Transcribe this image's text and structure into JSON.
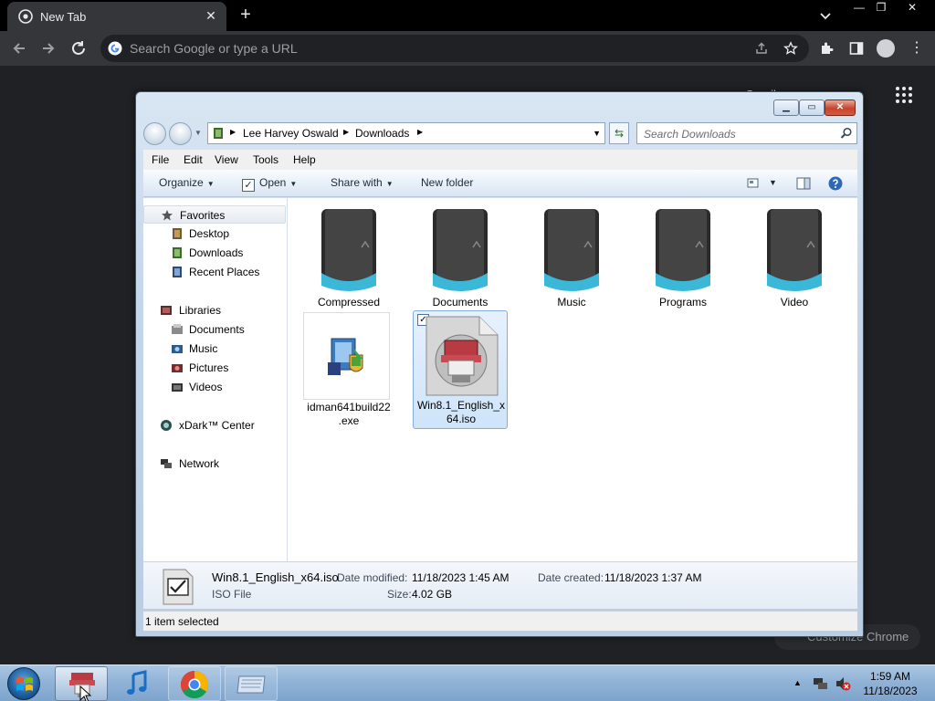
{
  "chrome": {
    "tab_title": "New Tab",
    "tab_close": "✕",
    "new_tab": "+",
    "omnibox_placeholder": "Search Google or type a URL",
    "menu_dots": "⋮",
    "gmail_link": "Gmail",
    "customize": "Customize Chrome",
    "window_min": "—",
    "window_restore": "❐",
    "window_close": "✕"
  },
  "explorer": {
    "breadcrumb": [
      "Lee Harvey Oswald",
      "Downloads"
    ],
    "search_placeholder": "Search Downloads",
    "menus": [
      "File",
      "Edit",
      "View",
      "Tools",
      "Help"
    ],
    "commands": {
      "organize": "Organize",
      "open": "Open",
      "share": "Share with",
      "new_folder": "New folder"
    },
    "nav": {
      "favorites": "Favorites",
      "favorites_items": [
        "Desktop",
        "Downloads",
        "Recent Places"
      ],
      "libraries": "Libraries",
      "libraries_items": [
        "Documents",
        "Music",
        "Pictures",
        "Videos"
      ],
      "xdark": "xDark™ Center",
      "network": "Network"
    },
    "folders": [
      "Compressed",
      "Documents",
      "Music",
      "Programs",
      "Video"
    ],
    "files": [
      {
        "name_line1": "idman641build22",
        "name_line2": ".exe"
      },
      {
        "name_line1": "Win8.1_English_x",
        "name_line2": "64.iso"
      }
    ],
    "details": {
      "filename": "Win8.1_English_x64.iso",
      "type": "ISO File",
      "date_modified_label": "Date modified:",
      "date_modified": "11/18/2023 1:45 AM",
      "date_created_label": "Date created:",
      "date_created": "11/18/2023 1:37 AM",
      "size_label": "Size:",
      "size": "4.02 GB"
    },
    "status": "1 item selected"
  },
  "taskbar": {
    "time": "1:59 AM",
    "date": "11/18/2023",
    "tray_arrow": "▲"
  },
  "colors": {
    "chrome_dark": "#35363a",
    "selection": "#cfe4fa",
    "taskbar": "#8fb1d6"
  }
}
